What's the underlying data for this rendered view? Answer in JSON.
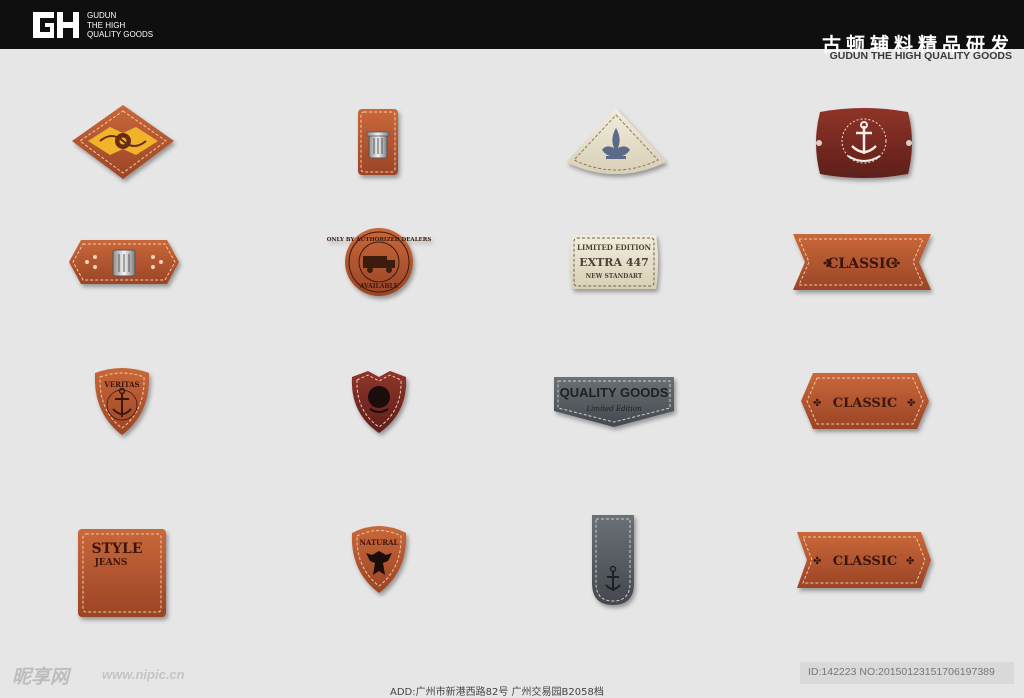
{
  "header": {
    "brand_line1": "GUDUN",
    "brand_line2": "THE HIGH",
    "brand_line3": "QUALITY GOODS",
    "title_cn": "古顿辅料精品研发",
    "title_en": "GUDUN THE HIGH QUALITY GOODS"
  },
  "labels": {
    "badge_truck_top": "ONLY BY AUTHORIZED DEALERS",
    "badge_truck_bottom": "AVAILABLE",
    "limited_line1": "LIMITED EDITION",
    "limited_line2": "EXTRA 447",
    "limited_line3": "NEW STANDART",
    "classic_1": "CLASSIC",
    "veritas": "VERITAS",
    "quality_goods": "QUALITY GOODS",
    "limited_script": "Limited Edition",
    "classic_2": "CLASSIC",
    "style_line1": "STYLE",
    "style_line2": "JEANS",
    "natural": "NATURAL",
    "classic_3": "CLASSIC"
  },
  "footer": {
    "watermark": "昵享网",
    "watermark_url": "www.nipic.cn",
    "id_text": "ID:142223 NO:20150123151706197389",
    "address": "ADD:广州市新港西路82号 广州交易园B2058档"
  },
  "colors": {
    "header_bg": "#0f0f0f",
    "page_bg": "#e7e6e6",
    "leather_tan": "#b5582e",
    "leather_dark": "#7a2c23",
    "cream": "#e9e3cf",
    "slate": "#5b6066"
  }
}
